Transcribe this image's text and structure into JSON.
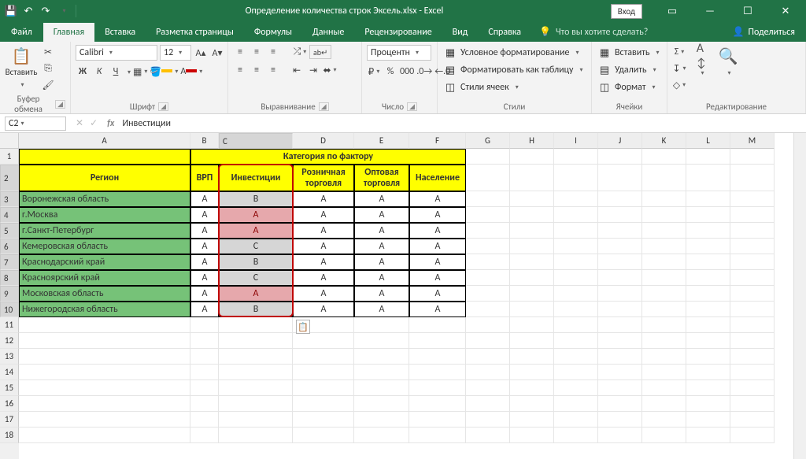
{
  "title": "Определение количества строк Эксель.xlsx  -  Excel",
  "signin": "Вход",
  "tabs": {
    "file": "Файл",
    "home": "Главная",
    "insert": "Вставка",
    "layout": "Разметка страницы",
    "formulas": "Формулы",
    "data": "Данные",
    "review": "Рецензирование",
    "view": "Вид",
    "help": "Справка",
    "tellme": "Что вы хотите сделать?",
    "share": "Поделиться"
  },
  "ribbon": {
    "clipboard": {
      "paste": "Вставить",
      "label": "Буфер обмена"
    },
    "font": {
      "name": "Calibri",
      "size": "12",
      "label": "Шрифт"
    },
    "align": {
      "label": "Выравнивание"
    },
    "number": {
      "format": "Процентн",
      "label": "Число"
    },
    "styles": {
      "cond": "Условное форматирование",
      "table": "Форматировать как таблицу",
      "cell": "Стили ячеек",
      "label": "Стили"
    },
    "cells": {
      "insert": "Вставить",
      "delete": "Удалить",
      "format": "Формат",
      "label": "Ячейки"
    },
    "editing": {
      "label": "Редактирование"
    }
  },
  "formulaBar": {
    "cellRef": "C2",
    "value": "Инвестиции"
  },
  "columns": [
    "A",
    "B",
    "C",
    "D",
    "E",
    "F",
    "G",
    "H",
    "I",
    "J",
    "K",
    "L",
    "M"
  ],
  "rows": [
    "1",
    "2",
    "3",
    "4",
    "5",
    "6",
    "7",
    "8",
    "9",
    "10",
    "11",
    "12",
    "13",
    "14",
    "15",
    "16",
    "17",
    "18"
  ],
  "table": {
    "catHeader": "Категория по фактору",
    "regionHeader": "Регион",
    "cols": {
      "B": "ВРП",
      "C": "Инвестиции",
      "D": "Розничная торговля",
      "E": "Оптовая торговля",
      "F": "Население"
    },
    "data": [
      {
        "region": "Воронежская область",
        "B": "A",
        "C": "B",
        "D": "A",
        "E": "A",
        "F": "A",
        "Cclass": "grayC"
      },
      {
        "region": "г.Москва",
        "B": "A",
        "C": "A",
        "D": "A",
        "E": "A",
        "F": "A",
        "Cclass": "pinkC"
      },
      {
        "region": "г.Санкт-Петербург",
        "B": "A",
        "C": "A",
        "D": "A",
        "E": "A",
        "F": "A",
        "Cclass": "pinkC"
      },
      {
        "region": "Кемеровская область",
        "B": "A",
        "C": "C",
        "D": "A",
        "E": "A",
        "F": "A",
        "Cclass": "grayC"
      },
      {
        "region": "Краснодарский край",
        "B": "A",
        "C": "B",
        "D": "A",
        "E": "A",
        "F": "A",
        "Cclass": "grayC"
      },
      {
        "region": "Красноярский край",
        "B": "A",
        "C": "C",
        "D": "A",
        "E": "A",
        "F": "A",
        "Cclass": "grayC"
      },
      {
        "region": "Московская область",
        "B": "A",
        "C": "A",
        "D": "A",
        "E": "A",
        "F": "A",
        "Cclass": "pinkC"
      },
      {
        "region": "Нижегородская область",
        "B": "A",
        "C": "B",
        "D": "A",
        "E": "A",
        "F": "A",
        "Cclass": "grayC"
      }
    ]
  }
}
